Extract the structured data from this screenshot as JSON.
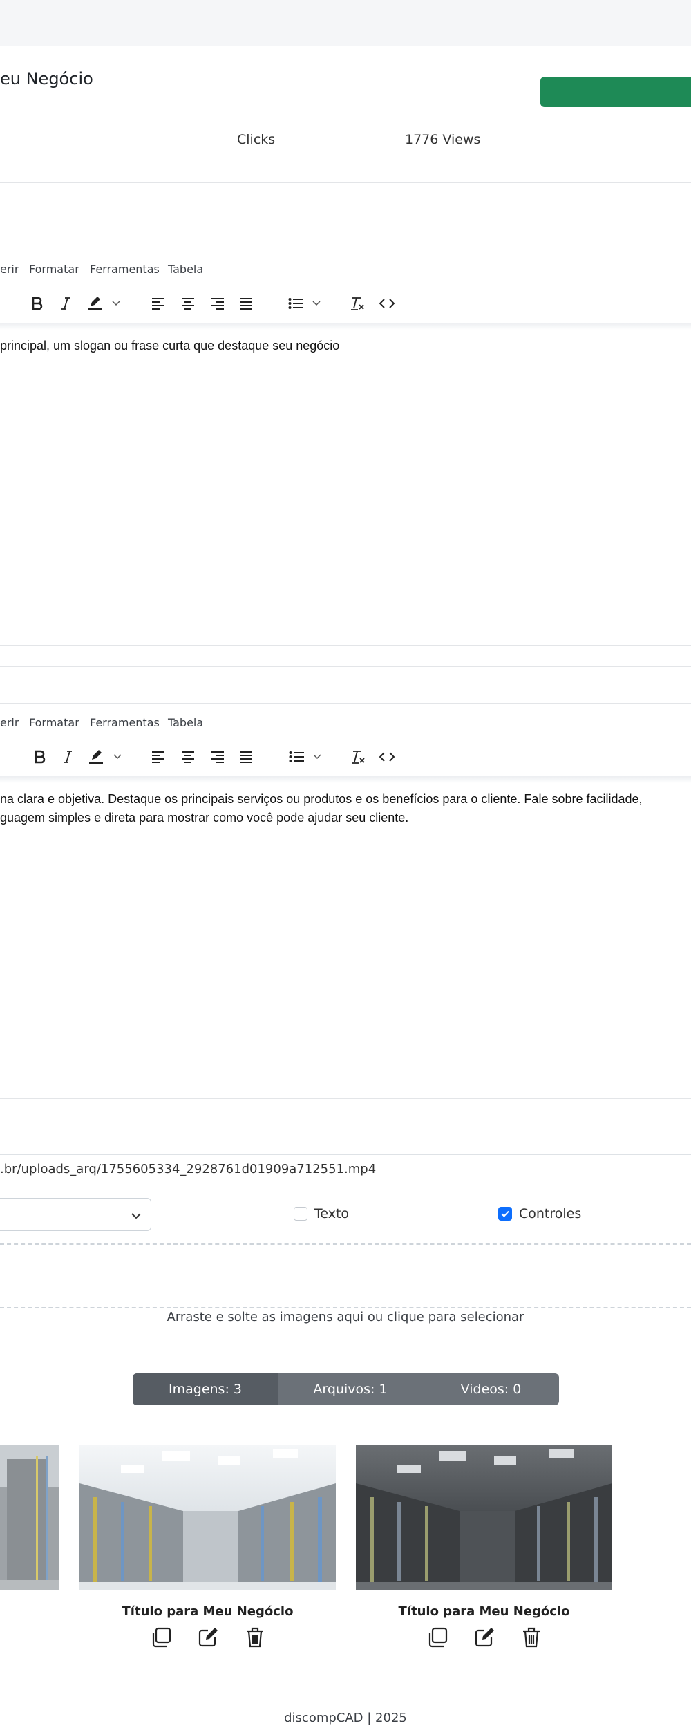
{
  "header": {
    "title": "eu Negócio"
  },
  "stats": {
    "clicks_label": "Clicks",
    "views_label": "1776 Views"
  },
  "editor1": {
    "menu": [
      "erir",
      "Formatar",
      "Ferramentas",
      "Tabela"
    ],
    "content": " principal, um slogan ou frase curta que destaque seu negócio"
  },
  "editor2": {
    "menu": [
      "erir",
      "Formatar",
      "Ferramentas",
      "Tabela"
    ],
    "content_line1": "na clara e objetiva. Destaque os principais serviços ou produtos e os benefícios para o cliente. Fale sobre facilidade,",
    "content_line2": "guagem simples e direta para mostrar como você pode ajudar seu cliente."
  },
  "video": {
    "url": ".br/uploads_arq/1755605334_2928761d01909a712551.mp4",
    "texto_label": "Texto",
    "texto_checked": false,
    "controles_label": "Controles",
    "controles_checked": true
  },
  "upload": {
    "hint": "Arraste e solte as imagens aqui ou clique para selecionar"
  },
  "counts": {
    "images": "Imagens: 3",
    "files": "Arquivos: 1",
    "videos": "Videos: 0"
  },
  "gallery": [
    {
      "title": "Título para Meu Negócio"
    },
    {
      "title": "Título para Meu Negócio"
    }
  ],
  "footer": {
    "text": "discompCAD | 2025"
  },
  "colors": {
    "accent_green": "#1e8a56",
    "checkbox_blue": "#0d6efd",
    "counts_bg": "#6b7178",
    "counts_active": "#565c63"
  }
}
